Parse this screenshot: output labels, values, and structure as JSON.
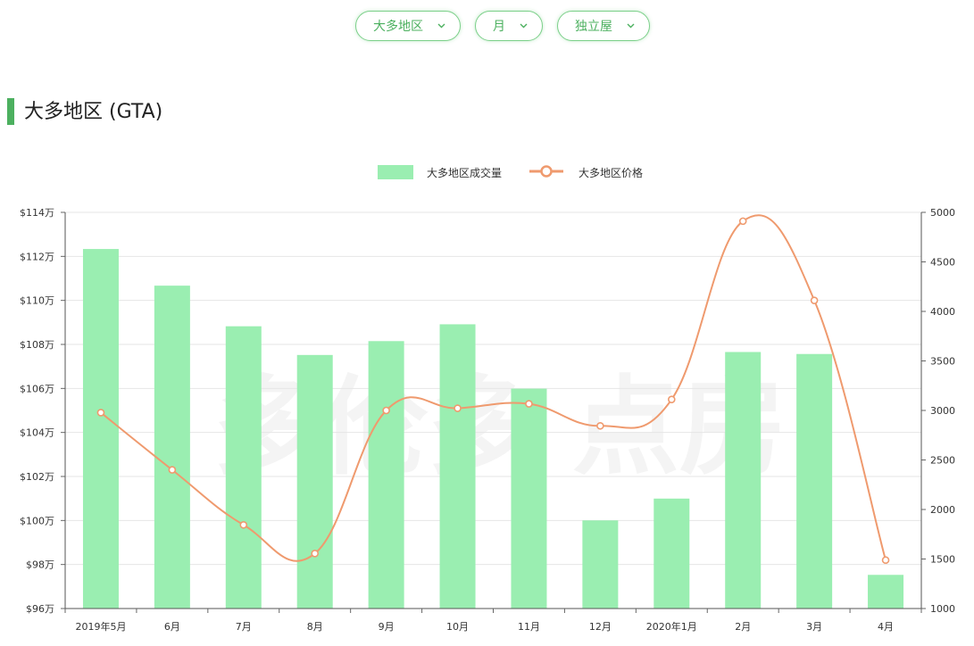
{
  "filters": [
    {
      "label": "大多地区"
    },
    {
      "label": "月"
    },
    {
      "label": "独立屋"
    }
  ],
  "section_title": "大多地区 (GTA)",
  "watermark": "多伦多 点房",
  "colors": {
    "accent": "#4cb05f",
    "bar": "#9aeeb1",
    "line": "#ef9a6e"
  },
  "chart_data": {
    "type": "bar",
    "categories": [
      "2019年5月",
      "6月",
      "7月",
      "8月",
      "9月",
      "10月",
      "11月",
      "12月",
      "2020年1月",
      "2月",
      "3月",
      "4月"
    ],
    "series": [
      {
        "name": "大多地区成交量",
        "type": "bar",
        "axis": "right",
        "values": [
          4630,
          4260,
          3850,
          3560,
          3700,
          3870,
          3220,
          1890,
          2110,
          3590,
          3570,
          1340
        ]
      },
      {
        "name": "大多地区价格",
        "type": "line",
        "axis": "left",
        "values": [
          104.9,
          102.3,
          99.8,
          98.5,
          105.0,
          105.1,
          105.3,
          104.3,
          105.5,
          113.6,
          110.0,
          98.2
        ]
      }
    ],
    "y_left": {
      "ylim": [
        96,
        114
      ],
      "ticks": [
        96,
        98,
        100,
        102,
        104,
        106,
        108,
        110,
        112,
        114
      ],
      "tick_labels": [
        "$96万",
        "$98万",
        "$100万",
        "$102万",
        "$104万",
        "$106万",
        "$108万",
        "$110万",
        "$112万",
        "$114万"
      ]
    },
    "y_right": {
      "ylim": [
        1000,
        5000
      ],
      "ticks": [
        1000,
        1500,
        2000,
        2500,
        3000,
        3500,
        4000,
        4500,
        5000
      ],
      "tick_labels": [
        "1000",
        "1500",
        "2000",
        "2500",
        "3000",
        "3500",
        "4000",
        "4500",
        "5000"
      ]
    },
    "grid": true,
    "legend_position": "top-center"
  }
}
